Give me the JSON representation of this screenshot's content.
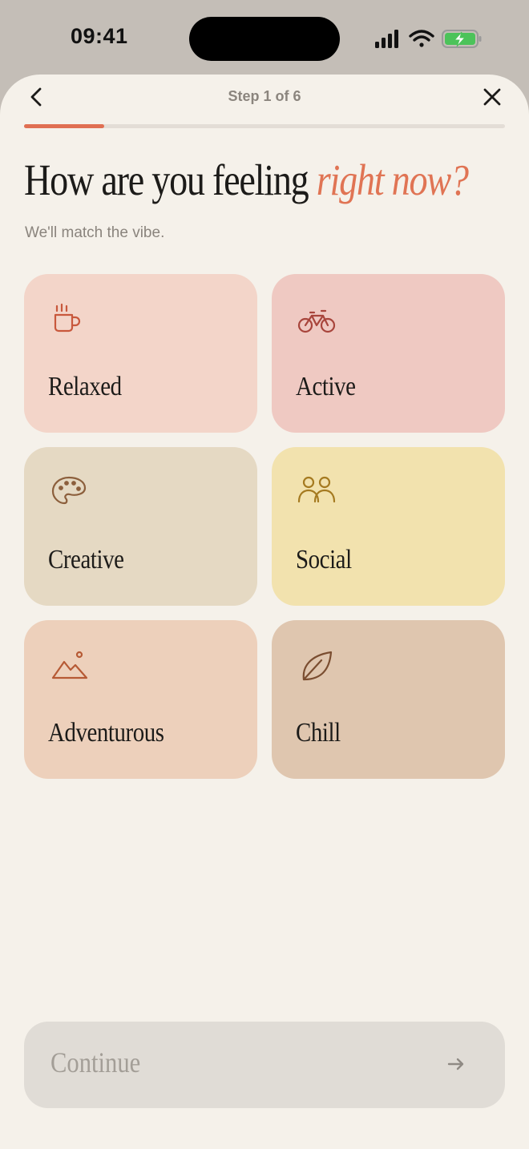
{
  "status_bar": {
    "time": "09:41",
    "icons": [
      "cellular-signal-icon",
      "wifi-icon",
      "battery-charging-icon"
    ]
  },
  "nav": {
    "step_label": "Step 1 of 6",
    "progress_fraction": 0.1667,
    "back_icon": "chevron-left-icon",
    "close_icon": "close-icon"
  },
  "heading": {
    "main": "How are you feeling ",
    "accent": "right now?",
    "subtitle": "We'll match the vibe."
  },
  "moods": [
    {
      "label": "Relaxed",
      "icon": "coffee-cup-icon",
      "bg": "#f3d5c9",
      "icon_color": "#c8583c"
    },
    {
      "label": "Active",
      "icon": "bicycle-icon",
      "bg": "#efc9c2",
      "icon_color": "#a8453c"
    },
    {
      "label": "Creative",
      "icon": "palette-icon",
      "bg": "#e5d9c3",
      "icon_color": "#8c5f3c"
    },
    {
      "label": "Social",
      "icon": "people-icon",
      "bg": "#f2e2ae",
      "icon_color": "#a57a20"
    },
    {
      "label": "Adventurous",
      "icon": "mountain-icon",
      "bg": "#edd0bb",
      "icon_color": "#b65a35"
    },
    {
      "label": "Chill",
      "icon": "leaf-icon",
      "bg": "#dfc6af",
      "icon_color": "#7a4d30"
    }
  ],
  "footer": {
    "continue_label": "Continue",
    "arrow_icon": "arrow-right-icon"
  },
  "colors": {
    "accent": "#e06f52",
    "background": "#f5f1ea",
    "text": "#1c1b19",
    "muted": "#8a847d",
    "button_disabled": "#e0dcd6"
  }
}
